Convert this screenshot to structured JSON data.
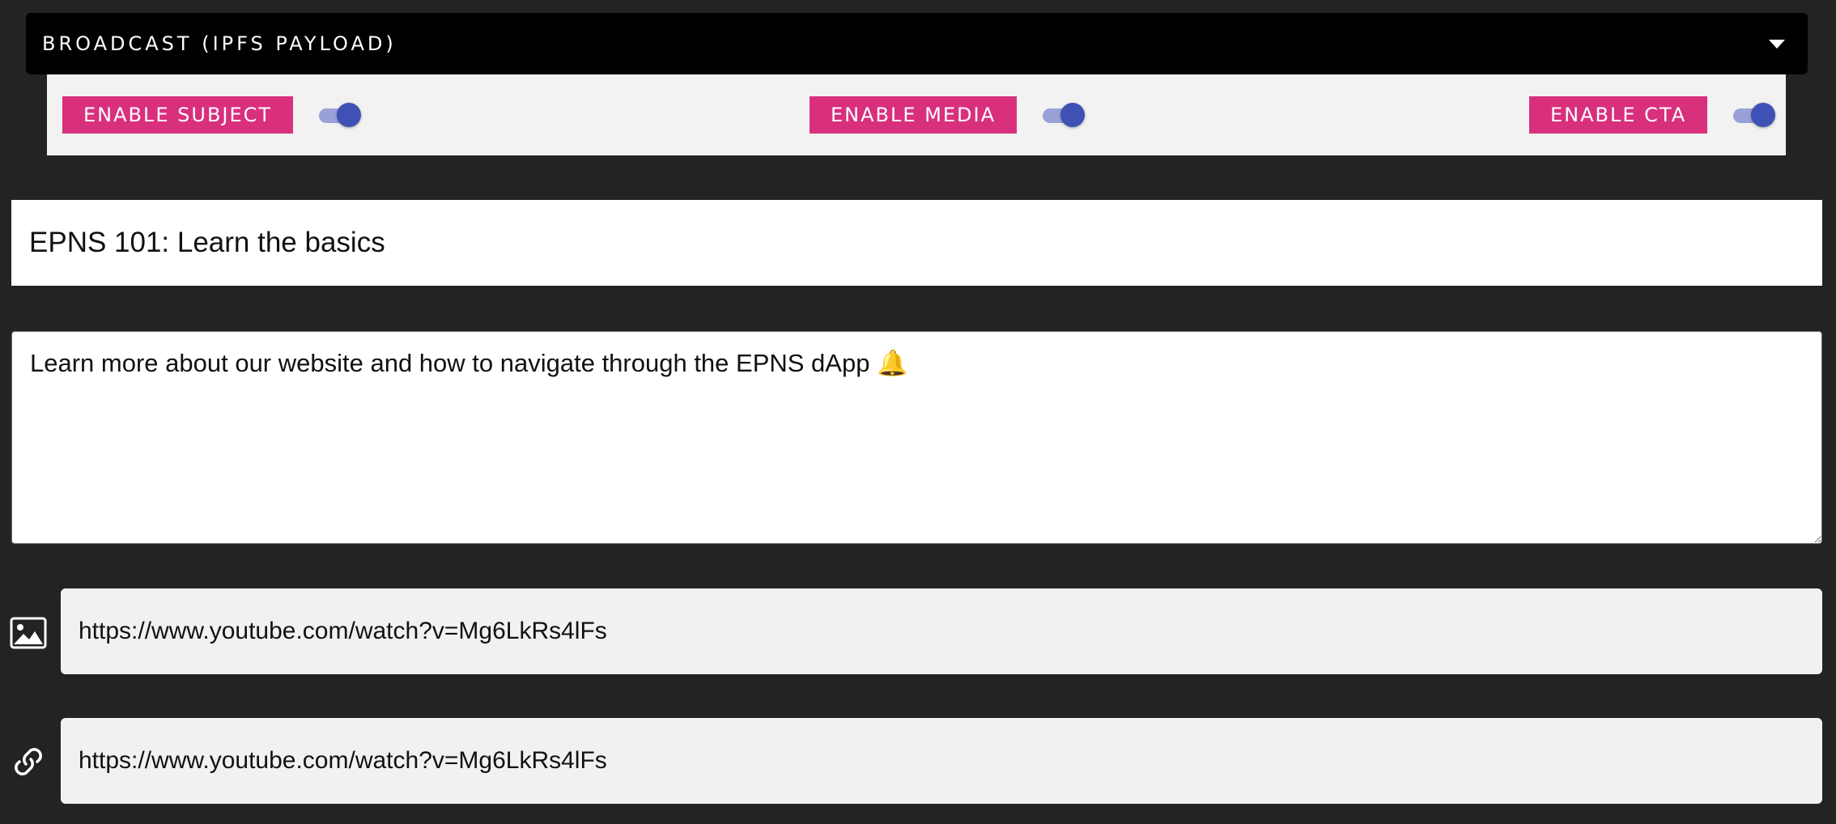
{
  "header": {
    "title": "BROADCAST (IPFS PAYLOAD)",
    "caret_icon": "caret-down-icon"
  },
  "toggles": [
    {
      "label": "ENABLE SUBJECT",
      "enabled": true
    },
    {
      "label": "ENABLE MEDIA",
      "enabled": true
    },
    {
      "label": "ENABLE CTA",
      "enabled": true
    }
  ],
  "subject": {
    "value": "EPNS 101: Learn the basics"
  },
  "message": {
    "value": "Learn more about our website and how to navigate through the EPNS dApp 🔔"
  },
  "media": {
    "icon": "image-icon",
    "value": "https://www.youtube.com/watch?v=Mg6LkRs4lFs"
  },
  "cta": {
    "icon": "link-icon",
    "value": "https://www.youtube.com/watch?v=Mg6LkRs4lFs"
  },
  "colors": {
    "background": "#232323",
    "header_bg": "#000000",
    "pink_button": "#d8307d",
    "switch_knob": "#3f51b5",
    "switch_track": "#9aa1d9",
    "panel_bg": "#f2f2f2"
  }
}
